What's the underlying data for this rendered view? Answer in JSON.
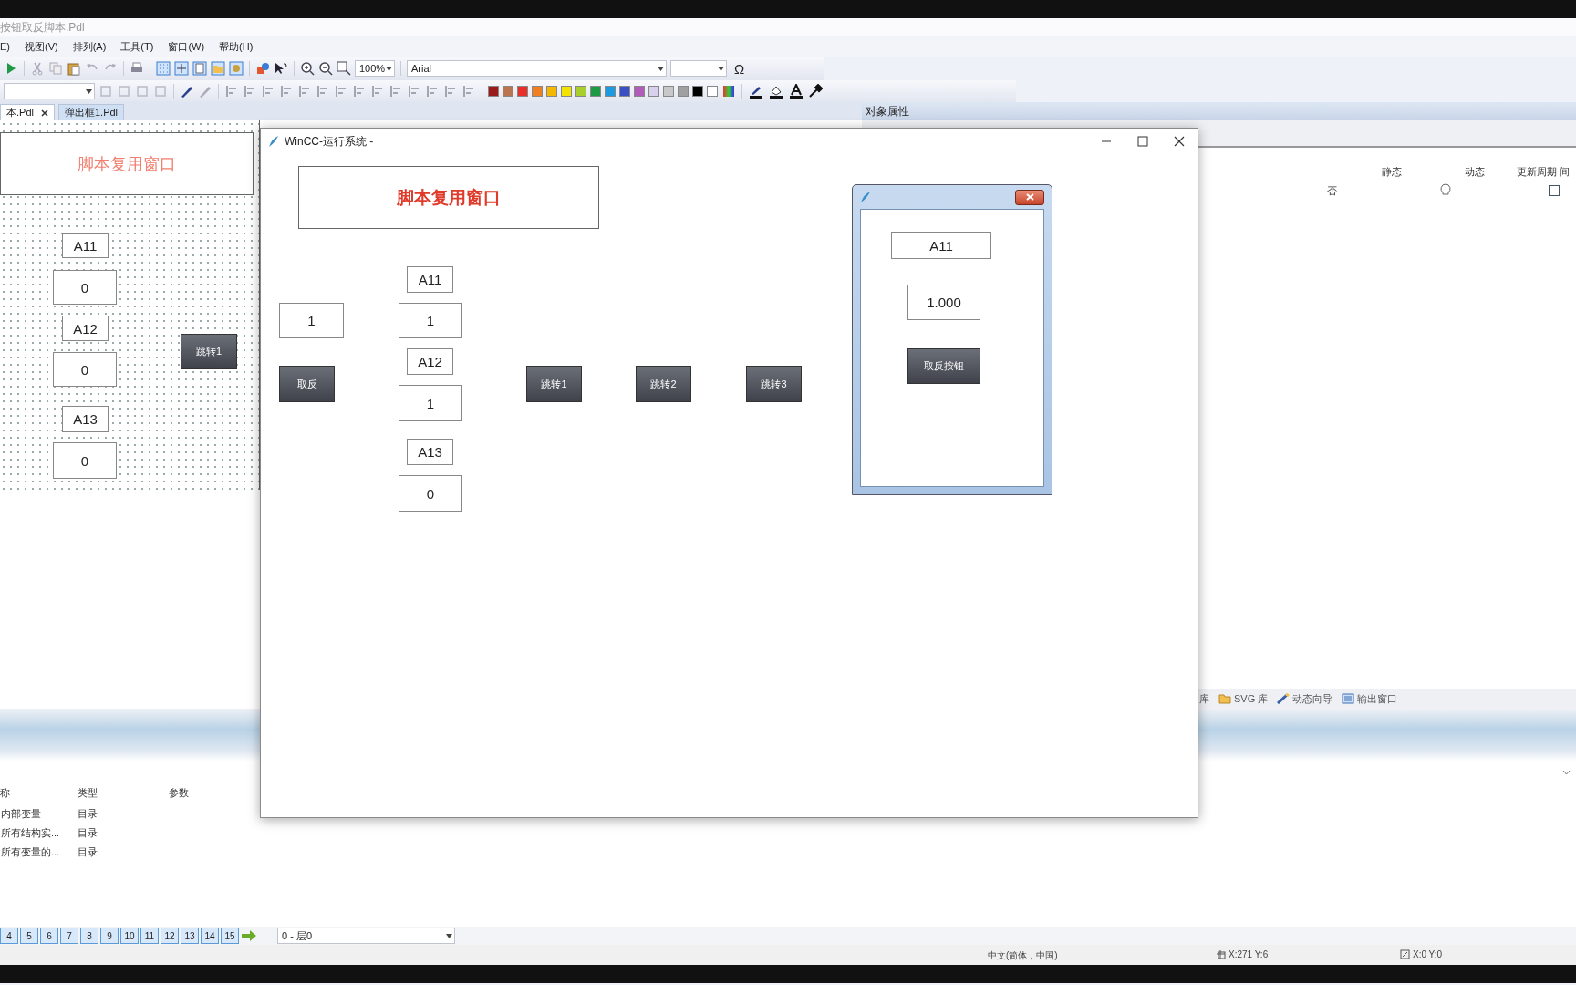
{
  "app_title": "按钮取反脚本.Pdl",
  "menu": [
    "E)",
    "视图(V)",
    "排列(A)",
    "工具(T)",
    "窗口(W)",
    "帮助(H)"
  ],
  "toolbar": {
    "zoom": "100%",
    "font": "Arial",
    "symbol": "Ω"
  },
  "palette": [
    {
      "color": "#9b1b1b"
    },
    {
      "color": "#b8754f"
    },
    {
      "color": "#e8302a"
    },
    {
      "color": "#f07f22"
    },
    {
      "color": "#f5b800"
    },
    {
      "color": "#f2e400"
    },
    {
      "color": "#a8cf2c"
    },
    {
      "color": "#1e9a45"
    },
    {
      "color": "#1e9ae0"
    },
    {
      "color": "#3a4fc4"
    },
    {
      "color": "#b05cb8"
    },
    {
      "color": "#d8d0ec"
    },
    {
      "color": "#c8c8c8"
    },
    {
      "color": "#a0a0a0"
    },
    {
      "color": "#000000"
    },
    {
      "color": "#ffffff"
    }
  ],
  "doc_tabs": [
    {
      "label": "本.Pdl",
      "selected": true,
      "closable": true
    },
    {
      "label": "弹出框1.Pdl",
      "selected": false,
      "closable": false
    }
  ],
  "editor_canvas": {
    "title": "脚本复用窗口",
    "objects": [
      {
        "kind": "label",
        "text": "A11"
      },
      {
        "kind": "field",
        "text": "0"
      },
      {
        "kind": "label",
        "text": "A12"
      },
      {
        "kind": "field",
        "text": "0"
      },
      {
        "kind": "label",
        "text": "A13"
      },
      {
        "kind": "field",
        "text": "0"
      },
      {
        "kind": "button",
        "text": "跳转1"
      }
    ]
  },
  "properties": {
    "title": "对象属性",
    "columns": [
      "静态",
      "动态",
      "更新周期",
      "间"
    ],
    "row": {
      "static": "否",
      "indirect_checked": false
    }
  },
  "side_tabs": [
    {
      "kind": "plain",
      "label": "库"
    },
    {
      "kind": "folder",
      "label": "SVG 库"
    },
    {
      "kind": "wand",
      "label": "动态向导"
    },
    {
      "kind": "window",
      "label": "输出窗口"
    }
  ],
  "tag_table": {
    "columns": [
      "称",
      "类型",
      "参数"
    ],
    "rows": [
      [
        "内部变量",
        "目录"
      ],
      [
        "所有结构实...",
        "目录"
      ],
      [
        "所有变量的...",
        "目录"
      ]
    ]
  },
  "layers": [
    "4",
    "5",
    "6",
    "7",
    "8",
    "9",
    "10",
    "11",
    "12",
    "13",
    "14",
    "15"
  ],
  "layer_select": "0 - 层0",
  "status": {
    "language": "中文(简体，中国)",
    "cursor": "X:271 Y:6",
    "size": "X:0 Y:0"
  },
  "runtime": {
    "title": "WinCC-运行系统 -",
    "header": "脚本复用窗口",
    "objects": [
      {
        "kind": "field",
        "text": "1"
      },
      {
        "kind": "button",
        "text": "取反"
      },
      {
        "kind": "label",
        "text": "A11"
      },
      {
        "kind": "field",
        "text": "1"
      },
      {
        "kind": "label",
        "text": "A12"
      },
      {
        "kind": "field",
        "text": "1"
      },
      {
        "kind": "label",
        "text": "A13"
      },
      {
        "kind": "field",
        "text": "0"
      },
      {
        "kind": "button",
        "text": "跳转1"
      },
      {
        "kind": "button",
        "text": "跳转2"
      },
      {
        "kind": "button",
        "text": "跳转3"
      }
    ]
  },
  "popup": {
    "objects": [
      {
        "kind": "label",
        "text": "A11"
      },
      {
        "kind": "field",
        "text": "1.000"
      },
      {
        "kind": "button",
        "text": "取反按钮"
      }
    ]
  }
}
